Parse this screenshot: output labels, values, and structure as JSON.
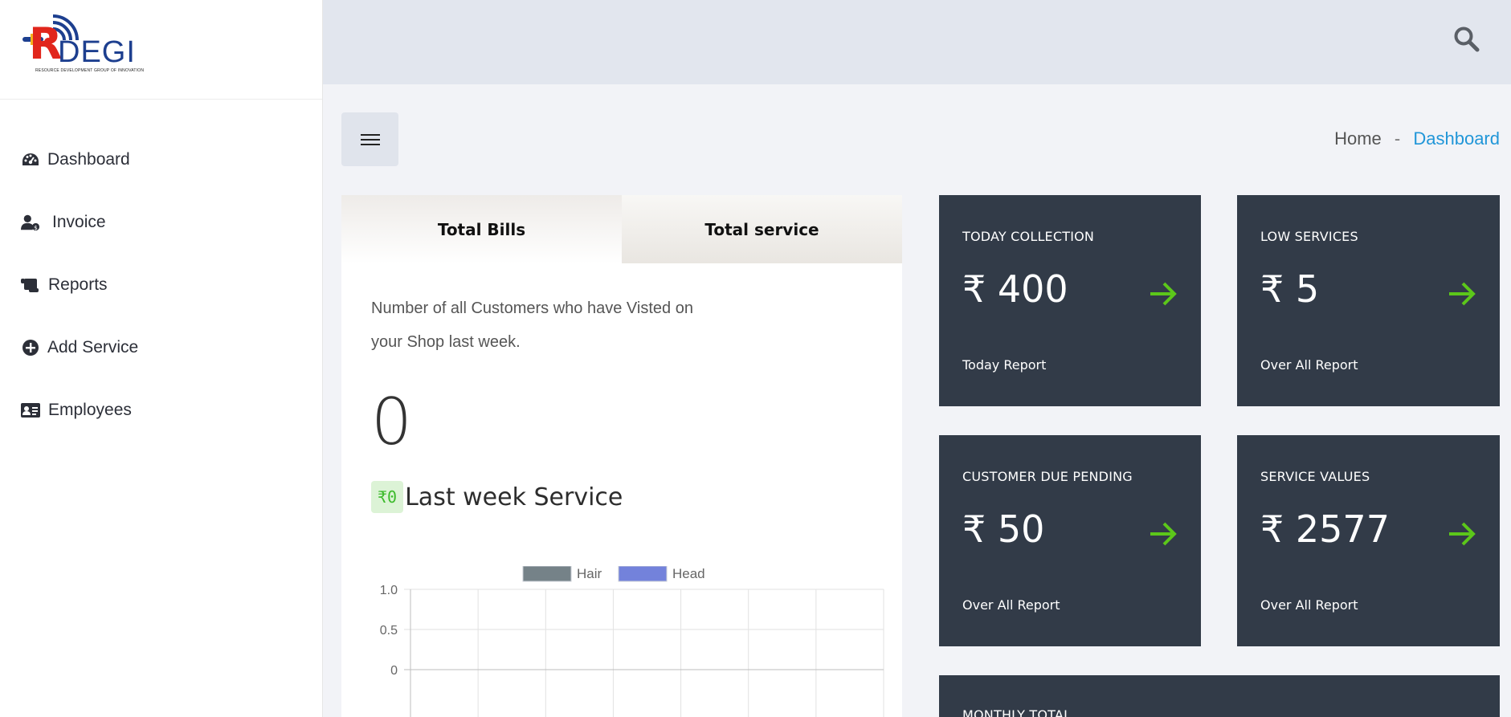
{
  "brand": {
    "logo_text": "RDEGI",
    "tagline": "RESOURCE DEVELOPMENT GROUP OF INNOVATION"
  },
  "sidebar": {
    "items": [
      {
        "label": "Dashboard",
        "icon": "dashboard-icon"
      },
      {
        "label": "Invoice",
        "icon": "user-invoice-icon"
      },
      {
        "label": "Reports",
        "icon": "scroll-icon"
      },
      {
        "label": "Add Service",
        "icon": "plus-circle-icon"
      },
      {
        "label": "Employees",
        "icon": "id-card-icon"
      }
    ]
  },
  "topbar": {
    "search_icon": "search-icon"
  },
  "breadcrumb": {
    "home": "Home",
    "separator": "-",
    "current": "Dashboard"
  },
  "card": {
    "tabs": [
      "Total Bills",
      "Total service"
    ],
    "description": "Number of all Customers who have Visted on your Shop last week.",
    "count": "0",
    "badge": "₹0",
    "last_week_label": "Last week Service"
  },
  "chart_data": {
    "type": "bar",
    "series": [
      {
        "name": "Hair",
        "values": [],
        "color": "#758288"
      },
      {
        "name": "Head",
        "values": [],
        "color": "#7382db"
      }
    ],
    "y_ticks": [
      "1.0",
      "0.5",
      "0"
    ],
    "ylim": [
      0,
      1
    ],
    "grid": true,
    "legend": "top-center"
  },
  "tiles": [
    {
      "title": "TODAY COLLECTION",
      "value": "₹ 400",
      "sub": "Today Report"
    },
    {
      "title": "LOW SERVICES",
      "value": "₹ 5",
      "sub": "Over All Report"
    },
    {
      "title": "CUSTOMER DUE PENDING",
      "value": "₹ 50",
      "sub": "Over All Report"
    },
    {
      "title": "SERVICE VALUES",
      "value": "₹ 2577",
      "sub": "Over All Report"
    },
    {
      "title": "MONTHLY TOTAL",
      "value": "",
      "sub": ""
    }
  ],
  "colors": {
    "tile_bg": "#323b48",
    "accent_green": "#5cc71a",
    "link_blue": "#2196d8",
    "topbar_bg": "#e2e6ee"
  }
}
